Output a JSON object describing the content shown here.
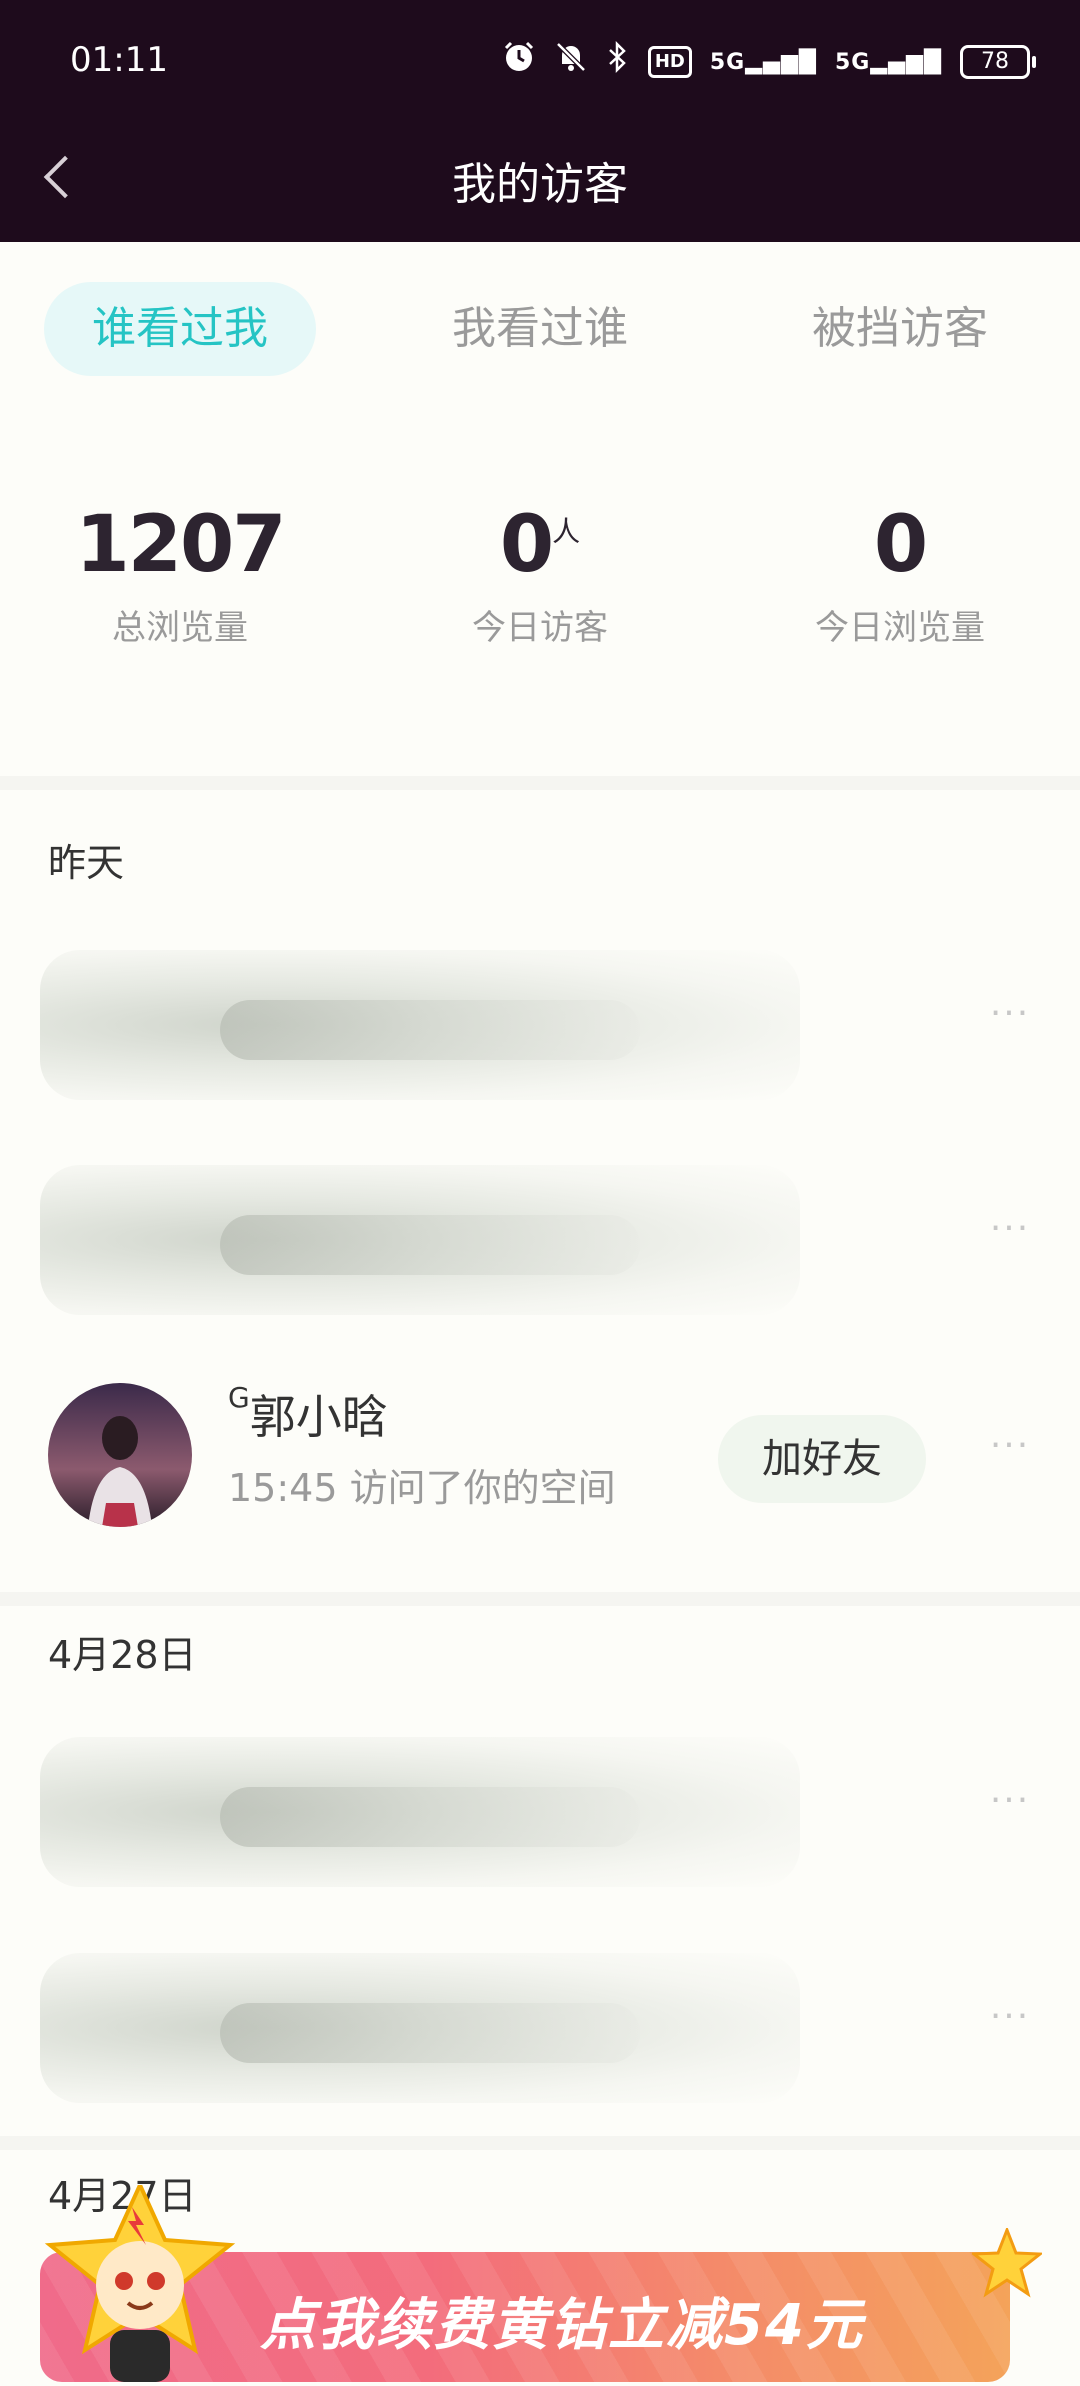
{
  "status_bar": {
    "time": "01:11",
    "icons": [
      "alarm-icon",
      "mute-icon",
      "bluetooth-icon",
      "hd-icon",
      "signal-5g-icon",
      "signal-5g-icon"
    ],
    "hd": "HD",
    "signal1": "5G",
    "signal2": "5G",
    "battery": "78"
  },
  "nav": {
    "title": "我的访客"
  },
  "tabs": [
    {
      "label": "谁看过我",
      "active": true
    },
    {
      "label": "我看过谁",
      "active": false
    },
    {
      "label": "被挡访客",
      "active": false
    }
  ],
  "stats": [
    {
      "value": "1207",
      "unit": "",
      "label": "总浏览量"
    },
    {
      "value": "0",
      "unit": "人",
      "label": "今日访客"
    },
    {
      "value": "0",
      "unit": "",
      "label": "今日浏览量"
    }
  ],
  "sections": [
    {
      "title": "昨天",
      "visitors": [
        {
          "name": "",
          "blurred": true,
          "more": "···"
        },
        {
          "name": "",
          "blurred": true,
          "more": "···"
        },
        {
          "name": "郭小晗",
          "name_prefix": "G",
          "subtitle": "15:45 访问了你的空间",
          "action": "加好友",
          "more": "···"
        }
      ]
    },
    {
      "title": "4月28日",
      "visitors": [
        {
          "name": "",
          "blurred": true,
          "more": "···"
        },
        {
          "name": "",
          "blurred": true,
          "more": "···"
        }
      ]
    },
    {
      "title": "4月27日"
    }
  ],
  "banner": {
    "text": "点我续费黄钻立减54元"
  },
  "colors": {
    "header_bg": "#1e0b1c",
    "tab_active": "#25c4c4",
    "tab_active_bg": "#e6f8f8"
  }
}
